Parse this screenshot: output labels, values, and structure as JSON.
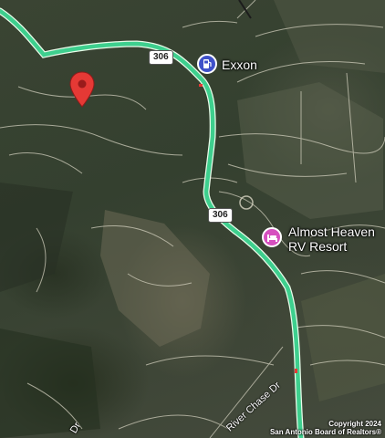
{
  "map": {
    "type": "satellite",
    "marker_icon": "map-pin-icon",
    "marker_color": "#e53935",
    "route_color": "#3ecf8e",
    "route_shield": "306",
    "route_shield_2": "306",
    "pois": [
      {
        "label": "Exxon",
        "icon": "gas-station-icon",
        "color": "#3f51c9"
      },
      {
        "label_line1": "Almost Heaven",
        "label_line2": "RV Resort",
        "icon": "bed-icon",
        "color": "#d64fbf"
      }
    ],
    "streets": [
      {
        "label": "River Chase Dr"
      },
      {
        "label": "Dr"
      }
    ],
    "copyright_line1": "Copyright 2024",
    "copyright_line2": "San Antonio Board of Realtors®"
  }
}
